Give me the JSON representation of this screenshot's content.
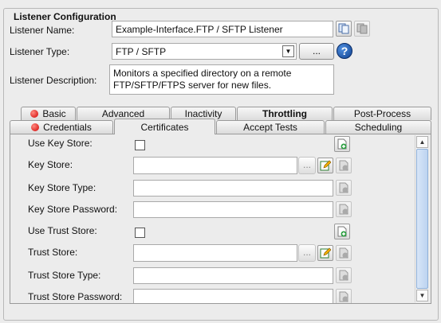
{
  "group": {
    "title": "Listener Configuration"
  },
  "listener": {
    "name_label": "Listener Name:",
    "name_value": "Example-Interface.FTP / SFTP Listener",
    "type_label": "Listener Type:",
    "type_value": "FTP / SFTP",
    "type_browse": "...",
    "help": "?",
    "desc_label": "Listener Description:",
    "desc_line1": "Monitors a specified directory on a remote",
    "desc_line2": "FTP/SFTP/FTPS server for new files."
  },
  "tabs": {
    "row1": [
      "Basic",
      "Advanced",
      "Inactivity",
      "Throttling",
      "Post-Process"
    ],
    "row2": [
      "Credentials",
      "Certificates",
      "Accept Tests",
      "Scheduling"
    ]
  },
  "certificates": {
    "use_key_store": "Use Key Store:",
    "key_store": "Key Store:",
    "key_store_type": "Key Store Type:",
    "key_store_password": "Key Store Password:",
    "use_trust_store": "Use Trust Store:",
    "trust_store": "Trust Store:",
    "trust_store_type": "Trust Store Type:",
    "trust_store_password": "Trust Store Password:",
    "browse": "..."
  },
  "icons": {
    "copy": "copy-icon",
    "paste": "paste-icon",
    "edit": "edit-icon",
    "add": "add-variable-icon",
    "help": "help-icon",
    "error": "error-dot-icon"
  }
}
